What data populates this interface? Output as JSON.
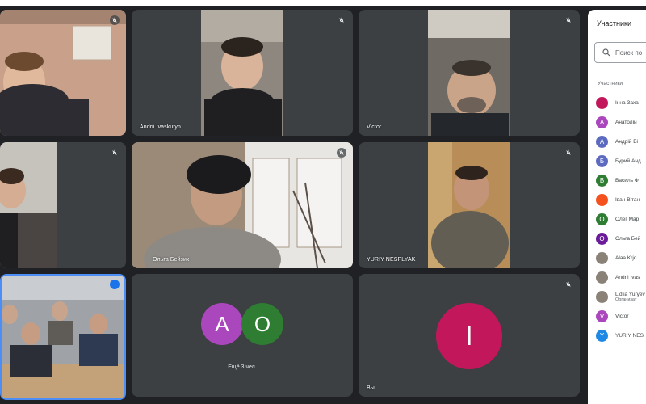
{
  "tiles": {
    "t1": {
      "name": ""
    },
    "t2": {
      "name": "Andrii Ivaskutyn"
    },
    "t3": {
      "name": "Victor"
    },
    "t4": {
      "name": ""
    },
    "t5": {
      "name": "Ольга Бейзик"
    },
    "t6": {
      "name": "YURIY NESPLYAK"
    },
    "t7": {
      "name": ""
    },
    "t8": {
      "avatar_a": "А",
      "avatar_o": "О",
      "more_label": "Ещё 3 чел."
    },
    "t9": {
      "avatar_i": "І",
      "name": "Вы"
    }
  },
  "panel": {
    "title": "Участники",
    "search_placeholder": "Поиск по",
    "section": "Участники",
    "participants": [
      {
        "initial": "І",
        "name": "Інна Заха",
        "color": "#c2185b"
      },
      {
        "initial": "А",
        "name": "Анатолій",
        "color": "#ab47bc"
      },
      {
        "initial": "А",
        "name": "Андрій Ві",
        "color": "#5c6bc0"
      },
      {
        "initial": "Б",
        "name": "Бурий Анд",
        "color": "#5c6bc0"
      },
      {
        "initial": "В",
        "name": "Василь Ф",
        "color": "#2e7d32"
      },
      {
        "initial": "І",
        "name": "Іван Вітан",
        "color": "#f4511e"
      },
      {
        "initial": "О",
        "name": "Олег Мар",
        "color": "#2e7d32"
      },
      {
        "initial": "О",
        "name": "Ольга Бей",
        "color": "#6a1b9a"
      },
      {
        "initial": "",
        "name": "Alaa Krjo",
        "color": "#8a8177"
      },
      {
        "initial": "",
        "name": "Andrii Ivas",
        "color": "#8a8177"
      },
      {
        "initial": "",
        "name": "Lidiia Yuryev",
        "sub": "Организат",
        "color": "#8a8177"
      },
      {
        "initial": "V",
        "name": "Victor",
        "color": "#ab47bc"
      },
      {
        "initial": "Y",
        "name": "YURIY NES",
        "color": "#1e88e5"
      }
    ]
  },
  "colors": {
    "background": "#202124",
    "tile": "#3c4043",
    "active_border": "#4c8df6",
    "avatar_a": "#ab47bc",
    "avatar_o": "#2e7d32",
    "avatar_i": "#c2185b"
  }
}
